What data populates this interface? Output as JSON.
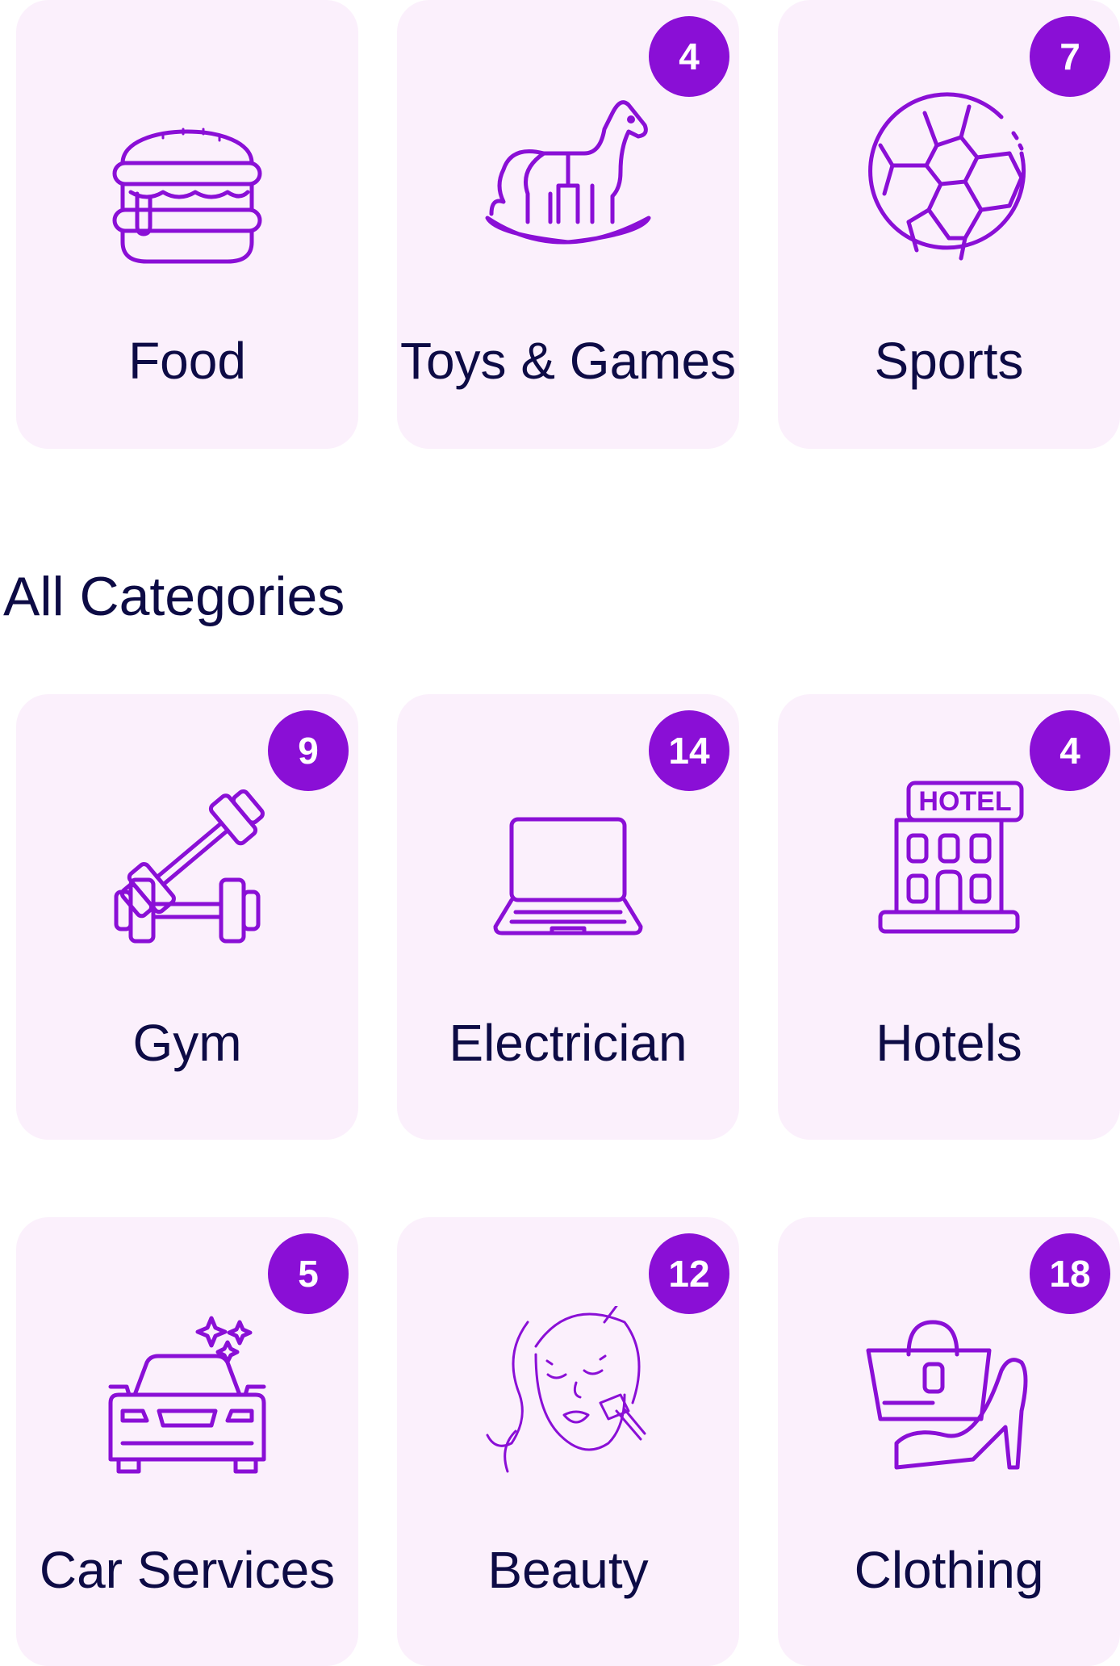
{
  "featured": [
    {
      "label": "Food",
      "badge": "",
      "icon": "burger-icon"
    },
    {
      "label": "Toys & Games",
      "badge": "4",
      "icon": "rocking-horse-icon"
    },
    {
      "label": "Sports",
      "badge": "7",
      "icon": "soccer-ball-icon"
    }
  ],
  "section": {
    "title": "All Categories"
  },
  "categories": [
    {
      "label": "Gym",
      "badge": "9",
      "icon": "dumbbell-icon"
    },
    {
      "label": "Electrician",
      "badge": "14",
      "icon": "laptop-icon"
    },
    {
      "label": "Hotels",
      "badge": "4",
      "icon": "hotel-icon",
      "sign": "HOTEL"
    },
    {
      "label": "Car Services",
      "badge": "5",
      "icon": "car-sparkle-icon"
    },
    {
      "label": "Beauty",
      "badge": "12",
      "icon": "makeup-face-icon"
    },
    {
      "label": "Clothing",
      "badge": "18",
      "icon": "bag-and-heel-icon"
    }
  ],
  "colors": {
    "accent": "#8a0fd6",
    "card": "#fbf0fc",
    "text": "#0d0b45"
  }
}
